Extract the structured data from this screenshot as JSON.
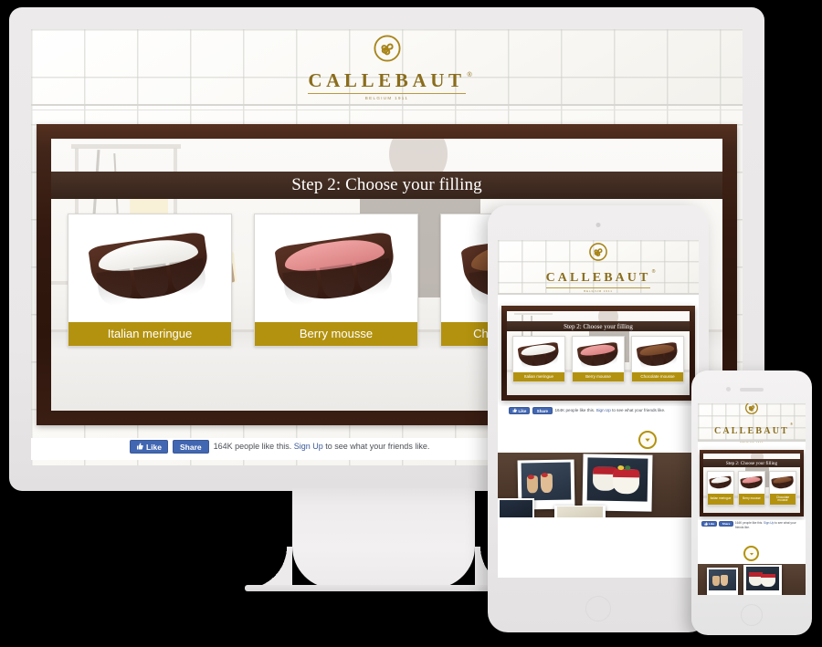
{
  "brand": {
    "name": "CALLEBAUT",
    "tagline": "BELGIUM 1911",
    "logo_icon": "callebaut-triskelion-logo",
    "gold": "#b3920f",
    "dark_brown": "#3a2318"
  },
  "desktop": {
    "device": "desktop-monitor",
    "step_title": "Step 2: Choose your filling",
    "cards": [
      {
        "label": "Italian meringue",
        "filling_color": "#f2f0ec"
      },
      {
        "label": "Berry mousse",
        "filling_color": "#e08f90"
      },
      {
        "label": "Chocolate mousse",
        "filling_color": "#7b4a2c"
      }
    ],
    "social": {
      "like_label": "Like",
      "share_label": "Share",
      "thumb_icon": "thumbs-up-icon",
      "count_text": "164K people like this.",
      "signup_label": "Sign Up",
      "tail_text": "to see what your friends like."
    }
  },
  "tablet": {
    "device": "tablet",
    "step_title": "Step 2: Choose your filling",
    "cards": [
      {
        "label": "Italian meringue",
        "filling_color": "#f2f0ec"
      },
      {
        "label": "Berry mousse",
        "filling_color": "#e08f90"
      },
      {
        "label": "Chocolate mousse",
        "filling_color": "#7b4a2c"
      }
    ],
    "social": {
      "like_label": "Like",
      "share_label": "Share",
      "thumb_icon": "thumbs-up-icon",
      "count_text": "164K people like this.",
      "signup_label": "Sign Up",
      "tail_text": "to see what your friends like."
    },
    "scroll_icon": "chevron-down-circle-icon"
  },
  "phone": {
    "device": "smartphone",
    "step_title": "Step 2: Choose your filling",
    "cards": [
      {
        "label": "Italian meringue",
        "filling_color": "#f2f0ec"
      },
      {
        "label": "Berry mousse",
        "filling_color": "#e08f90"
      },
      {
        "label": "Chocolate mousse",
        "filling_color": "#7b4a2c"
      }
    ],
    "social": {
      "like_label": "Like",
      "share_label": "Share",
      "thumb_icon": "thumbs-up-icon",
      "count_text": "164K people like this.",
      "signup_label": "Sign Up",
      "tail_text": "to see what your friends like."
    },
    "scroll_icon": "chevron-down-circle-icon"
  }
}
